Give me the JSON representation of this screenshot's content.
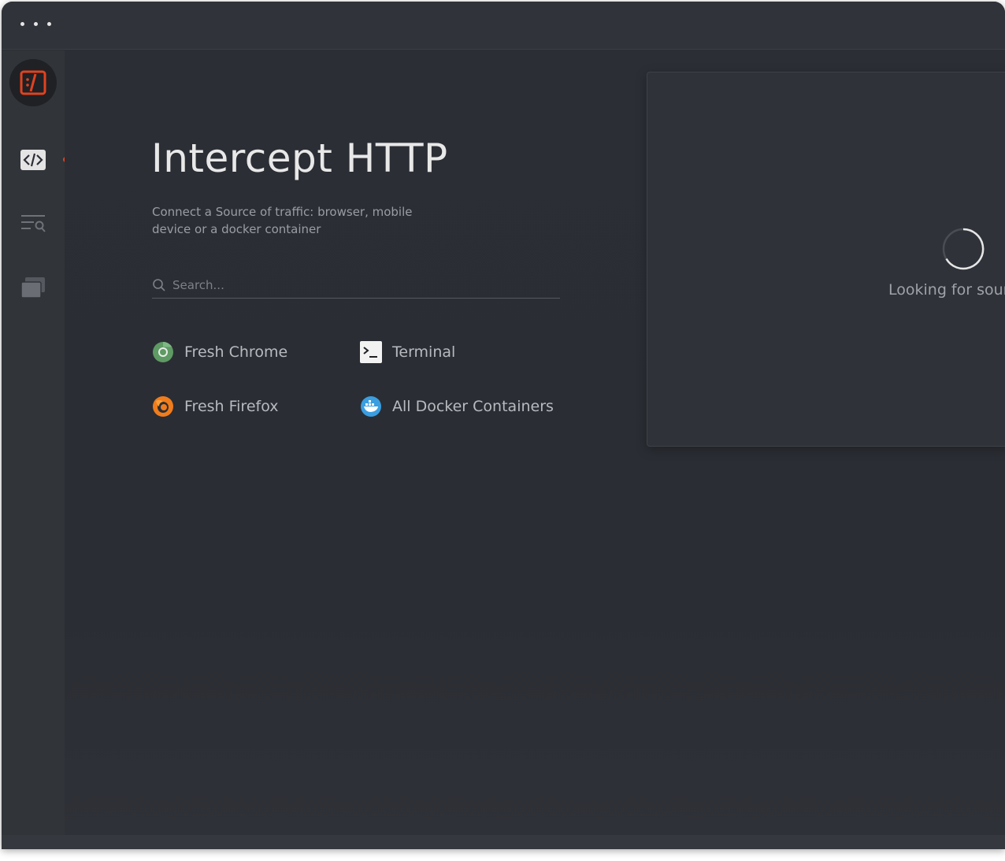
{
  "main": {
    "title": "Intercept HTTP",
    "subtitle": "Connect a Source of traffic: browser, mobile device or a docker container",
    "search": {
      "placeholder": "Search..."
    },
    "sources": [
      {
        "label": "Fresh Chrome",
        "icon": "chrome-icon"
      },
      {
        "label": "Terminal",
        "icon": "terminal-icon"
      },
      {
        "label": "Fresh Firefox",
        "icon": "firefox-icon"
      },
      {
        "label": "All Docker Containers",
        "icon": "docker-icon"
      }
    ]
  },
  "panel": {
    "status": "Looking for sour"
  },
  "sidebar": {
    "items": [
      {
        "icon": "code-icon",
        "active": true
      },
      {
        "icon": "search-list-icon"
      },
      {
        "icon": "windows-icon"
      }
    ]
  },
  "colors": {
    "accent": "#e1421f",
    "background": "#2b2e35",
    "sidebar": "#313439"
  }
}
